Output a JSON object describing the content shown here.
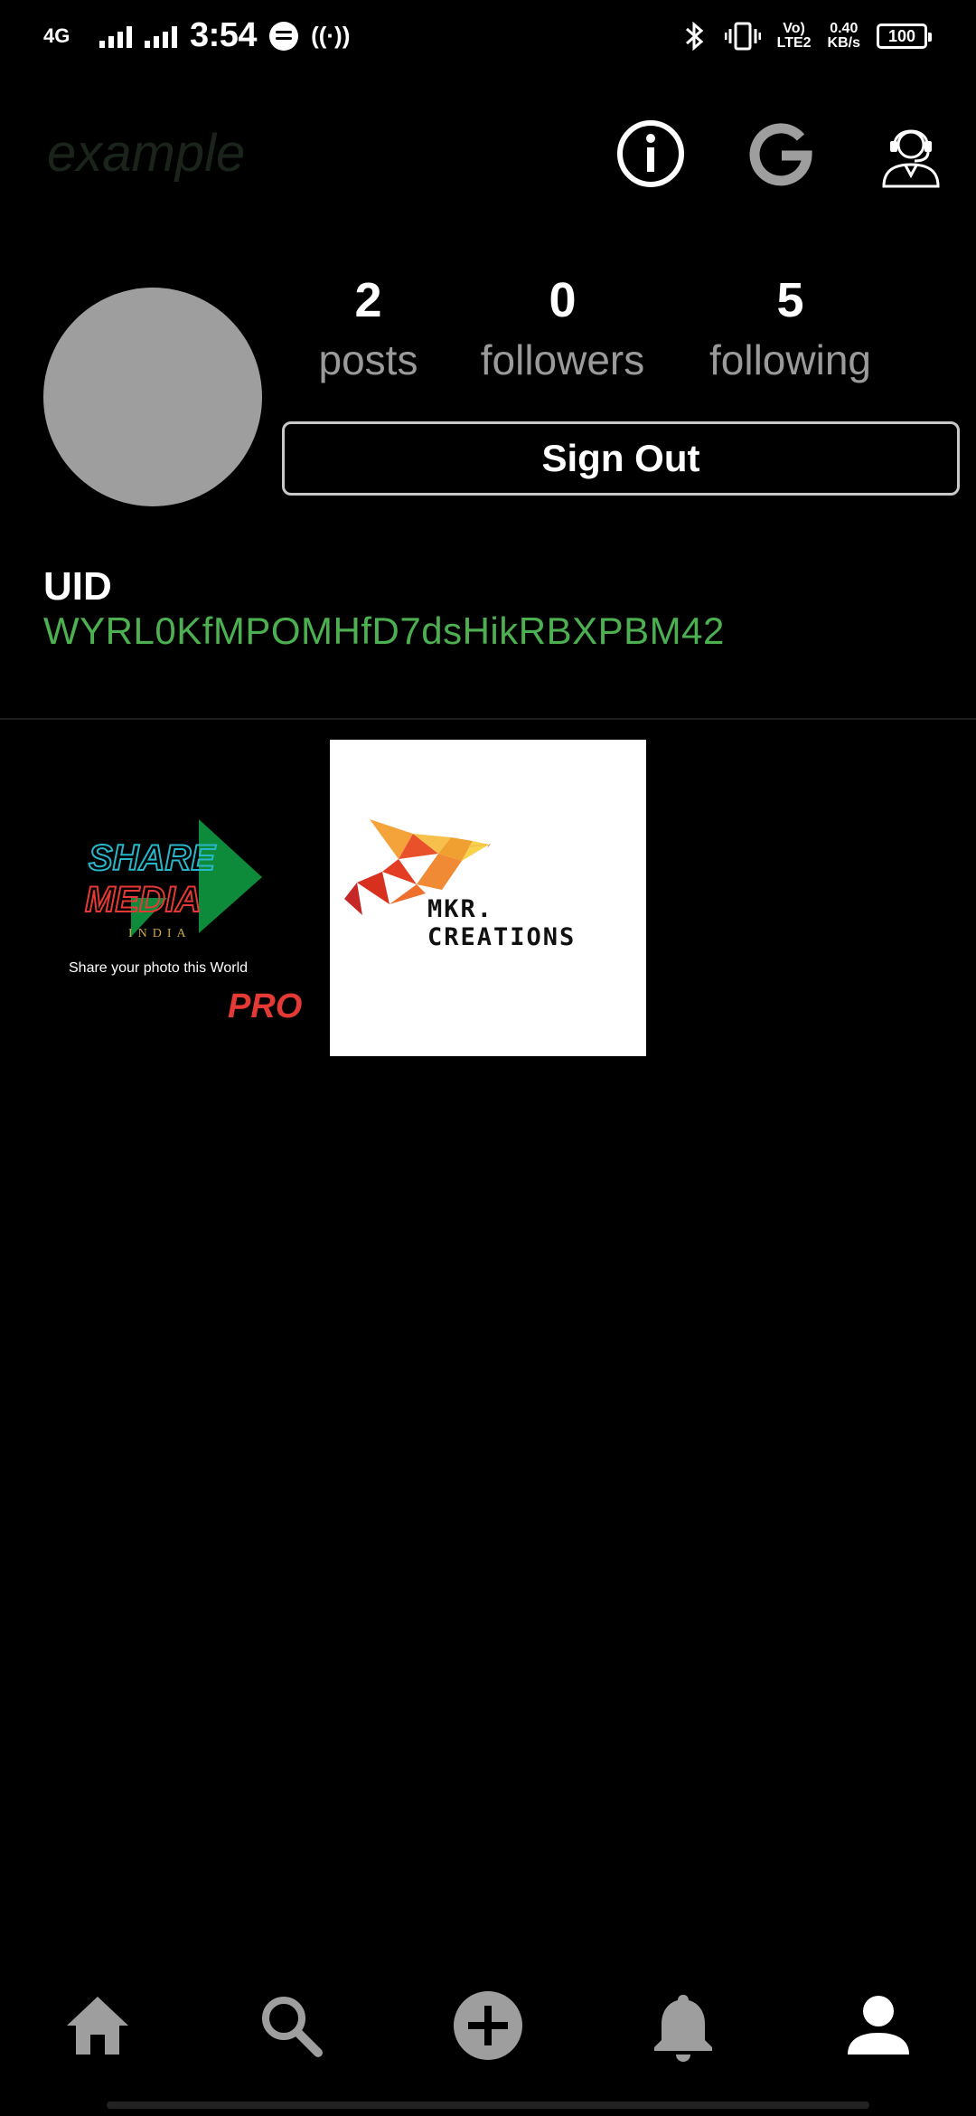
{
  "status_bar": {
    "network_type": "4G",
    "time": "3:54",
    "hotspot_symbol": "((·))",
    "volte_line1": "Vo)",
    "volte_line2": "LTE2",
    "speed_value": "0.40",
    "speed_unit": "KB/s",
    "battery": "100"
  },
  "header": {
    "app_title": "example",
    "icons": [
      "info-icon",
      "google-icon",
      "support-agent-icon"
    ]
  },
  "profile": {
    "stats": [
      {
        "value": "2",
        "label": "posts"
      },
      {
        "value": "0",
        "label": "followers"
      },
      {
        "value": "5",
        "label": "following"
      }
    ],
    "sign_out_label": "Sign Out",
    "uid_label": "UID",
    "uid_value": "WYRL0KfMPOMHfD7dsHikRBXPBM42"
  },
  "posts": [
    {
      "logo_line1": "SHARE",
      "logo_line2": "MEDIA",
      "logo_line3": "INDIA",
      "caption": "Share your photo this World",
      "badge": "PRO"
    },
    {
      "brand": "MKR. CREATIONS"
    }
  ],
  "bottom_nav": {
    "items": [
      "home-icon",
      "search-icon",
      "add-post-icon",
      "notifications-icon",
      "profile-icon"
    ],
    "active": "profile-icon"
  },
  "colors": {
    "background": "#000000",
    "uid_green": "#4caf50",
    "stat_label_gray": "#9a9a9a",
    "nav_inactive": "#9e9e9e",
    "nav_active": "#ffffff"
  }
}
